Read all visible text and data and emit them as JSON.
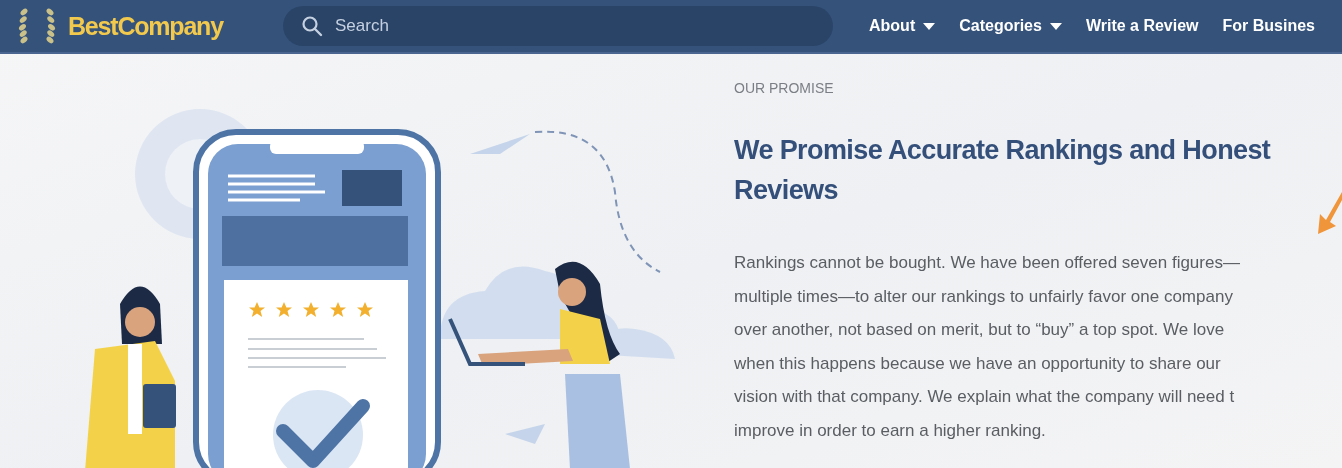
{
  "header": {
    "logo": "BestCompany",
    "search": {
      "placeholder": "Search"
    },
    "nav": [
      {
        "label": "About",
        "dropdown": true
      },
      {
        "label": "Categories",
        "dropdown": true
      },
      {
        "label": "Write a Review",
        "dropdown": false
      },
      {
        "label": "For Busines",
        "dropdown": false
      }
    ]
  },
  "section": {
    "eyebrow": "OUR PROMISE",
    "heading_lines": [
      "We Promise Accurate Rankings and Honest",
      "Reviews"
    ],
    "paragraph_lines": [
      "Rankings cannot be bought. We have been offered seven figures—",
      "multiple times—to alter our rankings to unfairly favor one company",
      "over another, not based on merit, but to “buy” a top spot. We love",
      "when this happens because we have an opportunity to share our",
      "vision with that company. We explain what the company will need t",
      "improve in order to earn a higher ranking."
    ],
    "stars": 5
  }
}
